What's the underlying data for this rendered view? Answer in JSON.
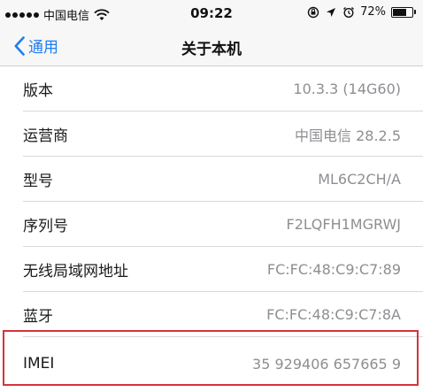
{
  "status_bar": {
    "carrier": "中国电信",
    "time": "09:22",
    "battery_percent": "72%",
    "battery_level": 0.72
  },
  "nav": {
    "back_label": "通用",
    "title": "关于本机"
  },
  "rows": [
    {
      "label": "版本",
      "value": "10.3.3 (14G60)"
    },
    {
      "label": "运营商",
      "value": "中国电信 28.2.5"
    },
    {
      "label": "型号",
      "value": "ML6C2CH/A"
    },
    {
      "label": "序列号",
      "value": "F2LQFH1MGRWJ"
    },
    {
      "label": "无线局域网地址",
      "value": "FC:FC:48:C9:C7:89"
    },
    {
      "label": "蓝牙",
      "value": "FC:FC:48:C9:C7:8A"
    },
    {
      "label": "IMEI",
      "value": "35 929406 657665 9"
    }
  ],
  "colors": {
    "accent": "#1e7cf2",
    "highlight_border": "#d4343a"
  },
  "icons": {
    "signal": "signal-dots-icon",
    "wifi": "wifi-icon",
    "rotation_lock": "rotation-lock-icon",
    "location": "location-arrow-icon",
    "alarm": "alarm-clock-icon",
    "battery": "battery-icon",
    "back": "chevron-left-icon"
  }
}
